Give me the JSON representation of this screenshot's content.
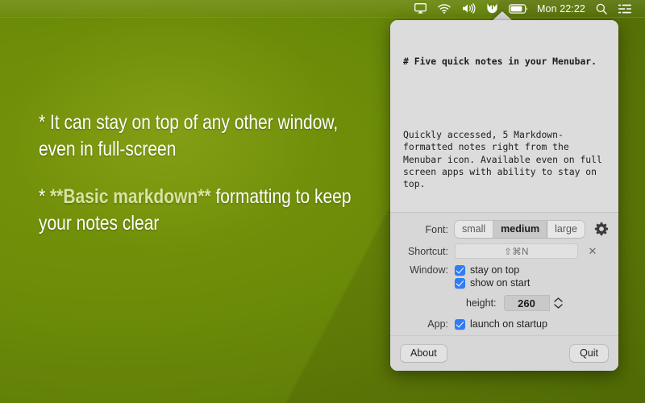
{
  "menubar": {
    "icons": [
      {
        "name": "airplay-icon"
      },
      {
        "name": "wifi-icon"
      },
      {
        "name": "volume-icon"
      },
      {
        "name": "menubar-notes-app-icon"
      },
      {
        "name": "battery-icon"
      }
    ],
    "clock": "Mon 22:22",
    "search_icon": "search-icon",
    "control_center_icon": "control-center-icon"
  },
  "desktop": {
    "note_line_1_bullet": "* ",
    "note_line_1": "It can stay on top of any other window, even in full-screen",
    "note_line_2_bullet": "* ",
    "note_line_2_bold": "**Basic markdown**",
    "note_line_2_rest": " formatting to keep your notes clear"
  },
  "popover": {
    "notes": {
      "heading": "# Five quick notes in your Menubar.",
      "body": "Quickly accessed, 5 Markdown-formatted notes right from the Menubar icon. Available even on full screen apps with ability to stay on top."
    },
    "settings": {
      "font_label": "Font:",
      "font_options": [
        "small",
        "medium",
        "large"
      ],
      "font_selected": "medium",
      "shortcut_label": "Shortcut:",
      "shortcut_value": "⇧⌘N",
      "shortcut_clear_icon": "clear-shortcut-icon",
      "window_label": "Window:",
      "stay_on_top_label": "stay on top",
      "show_on_start_label": "show on start",
      "height_label": "height:",
      "height_value": "260",
      "app_label": "App:",
      "launch_on_startup_label": "launch on startup",
      "gear_icon": "gear-icon"
    },
    "footer": {
      "about_label": "About",
      "quit_label": "Quit"
    }
  },
  "colors": {
    "desktop_green": "#6d8d09",
    "markdown_bold": "#d8e3a0",
    "checkbox_blue": "#2f7cf6",
    "panel_bg": "#dcdcdc"
  }
}
